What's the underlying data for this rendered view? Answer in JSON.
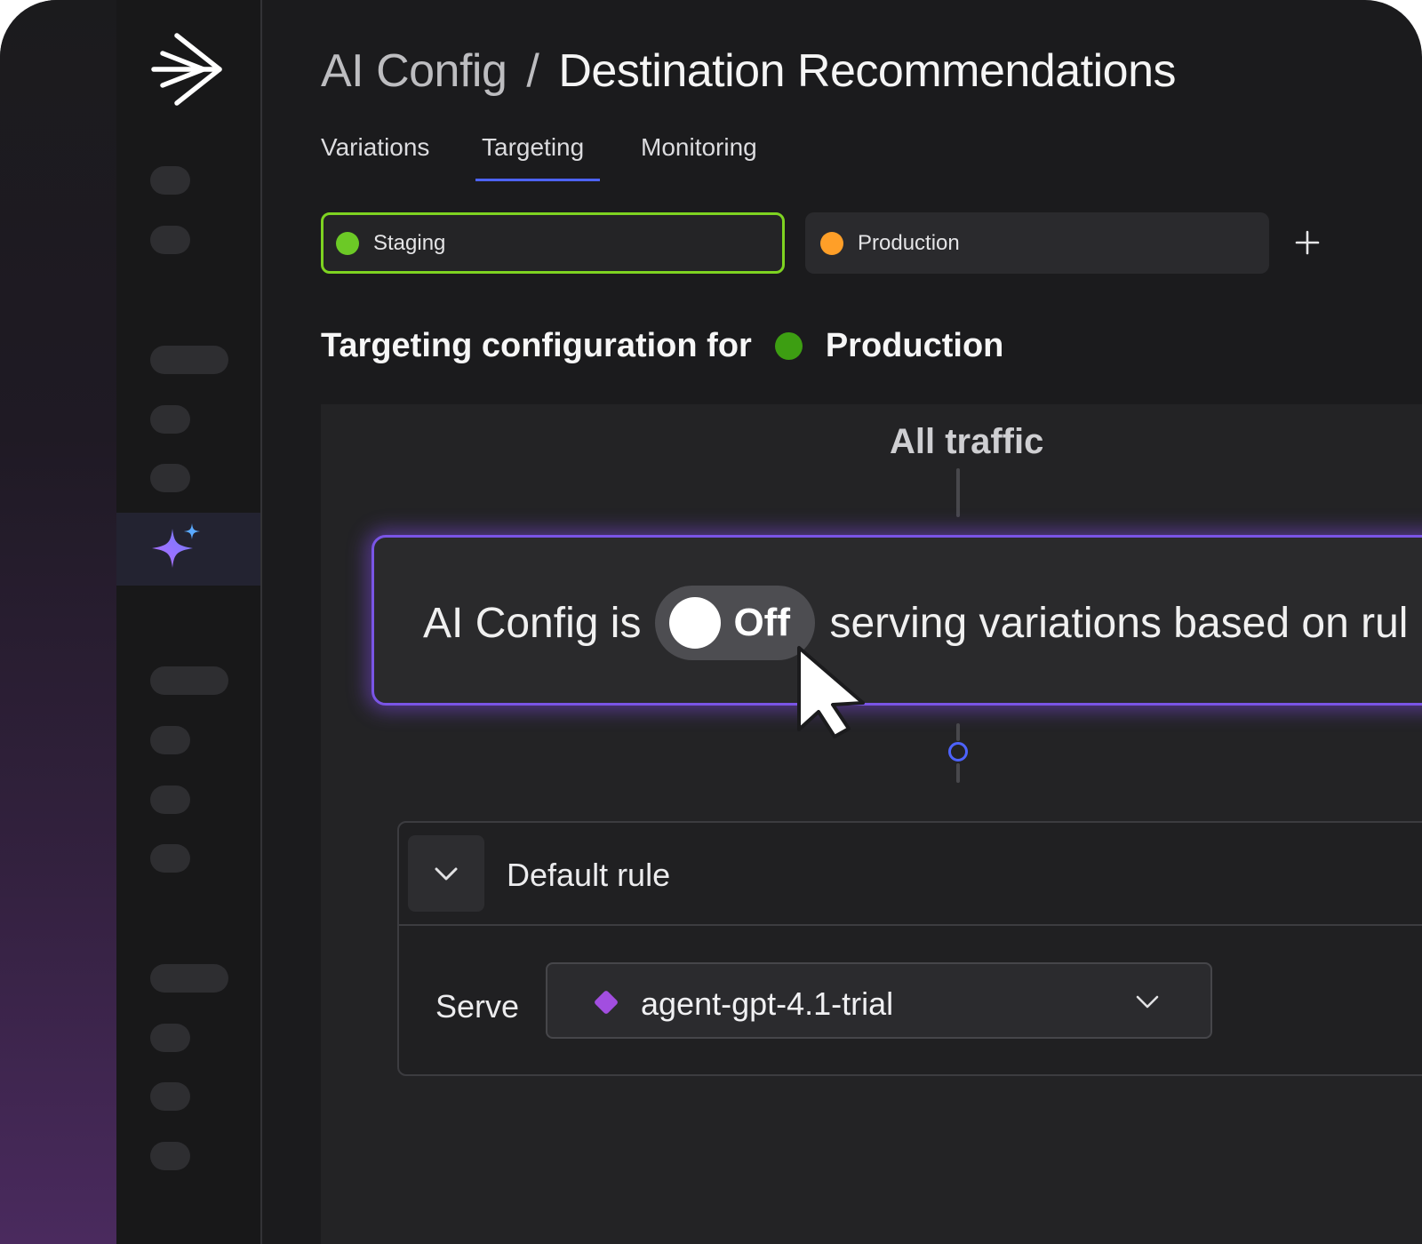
{
  "breadcrumb": {
    "parent": "AI Config",
    "separator": "/",
    "current": "Destination Recommendations"
  },
  "tabs": [
    {
      "label": "Variations",
      "active": false
    },
    {
      "label": "Targeting",
      "active": true
    },
    {
      "label": "Monitoring",
      "active": false
    }
  ],
  "environments": [
    {
      "label": "Staging",
      "color": "#6cc926",
      "selected": true
    },
    {
      "label": "Production",
      "color": "#ff9f28",
      "selected": false
    }
  ],
  "add_environment_icon": "plus-icon",
  "targeting": {
    "heading_prefix": "Targeting configuration for",
    "environment": "Production",
    "environment_color": "#3d9e12"
  },
  "flow": {
    "all_traffic_label": "All traffic",
    "status_prefix": "AI Config is",
    "toggle_state": "Off",
    "status_suffix": "serving variations based on rul"
  },
  "default_rule": {
    "title": "Default rule",
    "serve_label": "Serve",
    "variation": "agent-gpt-4.1-trial",
    "variation_color": "#a24ee0"
  },
  "colors": {
    "accent": "#4d63ff",
    "card_glow": "#7a55e6",
    "staging_border": "#7ed321"
  }
}
